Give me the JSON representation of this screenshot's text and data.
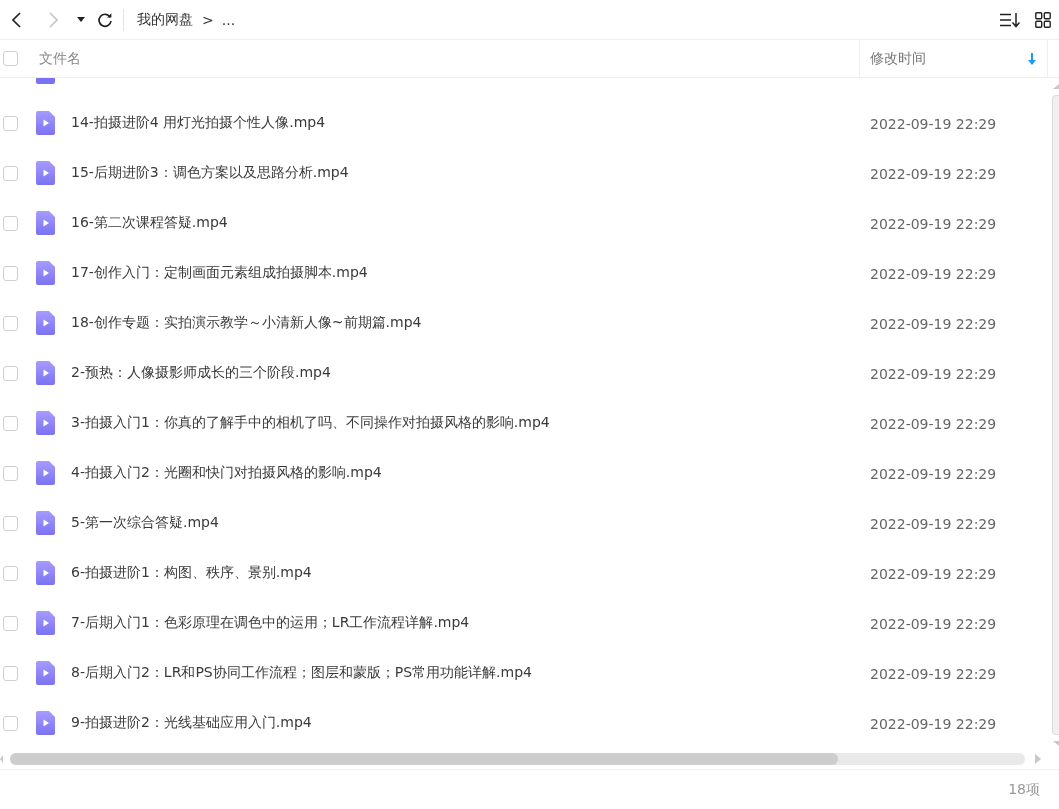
{
  "toolbar": {
    "back": {
      "disabled": false
    },
    "forward": {
      "disabled": true
    },
    "breadcrumb": [
      {
        "kind": "link",
        "label": "我的网盘"
      },
      {
        "kind": "separator",
        "label": ">"
      },
      {
        "kind": "more",
        "label": "..."
      }
    ]
  },
  "table": {
    "select_all": {
      "checked": false
    },
    "columns": [
      {
        "label": "文件名",
        "sorted": false
      },
      {
        "label": "修改时间",
        "sorted": true,
        "descending": true
      }
    ],
    "rows": [
      {
        "kind": "clipped"
      },
      {
        "kind": "video",
        "name": "14-拍摄进阶4 用灯光拍摄个性人像.mp4",
        "modified": "2022-09-19 22:29",
        "checked": false
      },
      {
        "kind": "video",
        "name": "15-后期进阶3：调色方案以及思路分析.mp4",
        "modified": "2022-09-19 22:29",
        "checked": false
      },
      {
        "kind": "video",
        "name": "16-第二次课程答疑.mp4",
        "modified": "2022-09-19 22:29",
        "checked": false
      },
      {
        "kind": "video",
        "name": "17-创作入门：定制画面元素组成拍摄脚本.mp4",
        "modified": "2022-09-19 22:29",
        "checked": false
      },
      {
        "kind": "video",
        "name": "18-创作专题：实拍演示教学～小清新人像~前期篇.mp4",
        "modified": "2022-09-19 22:29",
        "checked": false
      },
      {
        "kind": "video",
        "name": "2-预热：人像摄影师成长的三个阶段.mp4",
        "modified": "2022-09-19 22:29",
        "checked": false
      },
      {
        "kind": "video",
        "name": "3-拍摄入门1：你真的了解手中的相机了吗、不同操作对拍摄风格的影响.mp4",
        "modified": "2022-09-19 22:29",
        "checked": false
      },
      {
        "kind": "video",
        "name": "4-拍摄入门2：光圈和快门对拍摄风格的影响.mp4",
        "modified": "2022-09-19 22:29",
        "checked": false
      },
      {
        "kind": "video",
        "name": "5-第一次综合答疑.mp4",
        "modified": "2022-09-19 22:29",
        "checked": false
      },
      {
        "kind": "video",
        "name": "6-拍摄进阶1：构图、秩序、景别.mp4",
        "modified": "2022-09-19 22:29",
        "checked": false
      },
      {
        "kind": "video",
        "name": "7-后期入门1：色彩原理在调色中的运用；LR工作流程详解.mp4",
        "modified": "2022-09-19 22:29",
        "checked": false
      },
      {
        "kind": "video",
        "name": "8-后期入门2：LR和PS协同工作流程；图层和蒙版；PS常用功能详解.mp4",
        "modified": "2022-09-19 22:29",
        "checked": false
      },
      {
        "kind": "video",
        "name": "9-拍摄进阶2：光线基础应用入门.mp4",
        "modified": "2022-09-19 22:29",
        "checked": false
      }
    ]
  },
  "status_bar": {
    "count": "18项"
  }
}
